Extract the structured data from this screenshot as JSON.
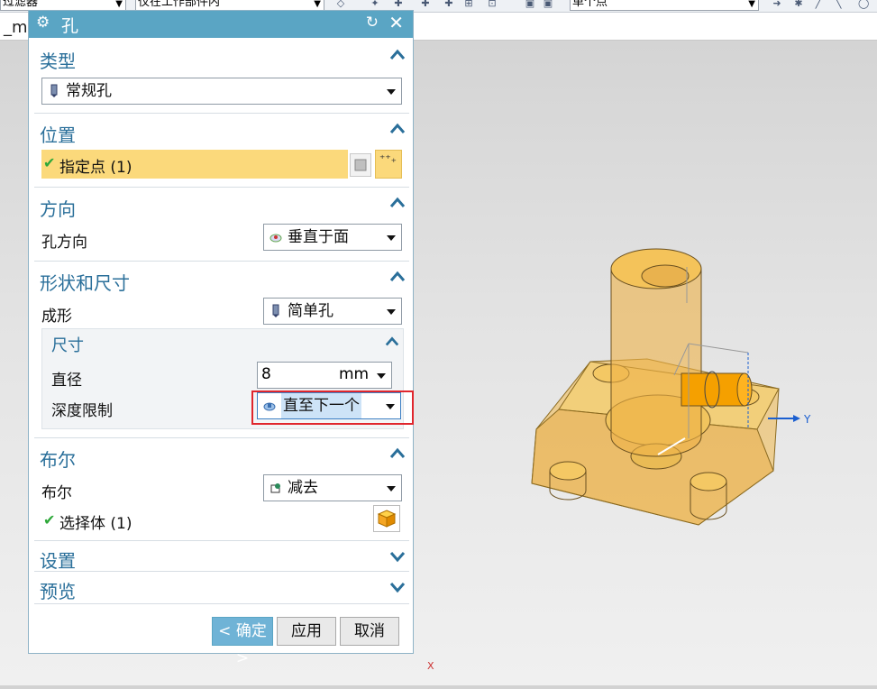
{
  "toolbar": {
    "filter_combo": "过滤器",
    "scope_combo": "仅在工作部件内",
    "snap_combo": "单个点"
  },
  "tab": {
    "name": "_mo"
  },
  "dialog": {
    "title": "孔",
    "sections": {
      "type": {
        "title": "类型",
        "combo_value": "常规孔"
      },
      "position": {
        "title": "位置",
        "specify_point": "指定点 (1)"
      },
      "direction": {
        "title": "方向",
        "hole_direction_label": "孔方向",
        "hole_direction_value": "垂直于面"
      },
      "shape": {
        "title": "形状和尺寸",
        "form_label": "成形",
        "form_value": "简单孔",
        "dimensions": {
          "title": "尺寸",
          "diameter_label": "直径",
          "diameter_value": "8",
          "diameter_unit": "mm",
          "depth_limit_label": "深度限制",
          "depth_limit_value": "直至下一个"
        }
      },
      "boolean": {
        "title": "布尔",
        "boolean_label": "布尔",
        "boolean_value": "减去",
        "select_body": "选择体 (1)"
      },
      "settings": {
        "title": "设置"
      },
      "preview": {
        "title": "预览"
      }
    },
    "buttons": {
      "ok": "< 确定 >",
      "apply": "应用",
      "cancel": "取消"
    }
  },
  "viewport": {
    "axis_y": "Y",
    "axis_x": "X"
  },
  "colors": {
    "title_bar": "#5aa5c4",
    "section_title": "#2a6f9a",
    "selection_yellow": "#fbd97b",
    "highlight_red": "#e0262d",
    "part_orange": "#f0b84a"
  }
}
